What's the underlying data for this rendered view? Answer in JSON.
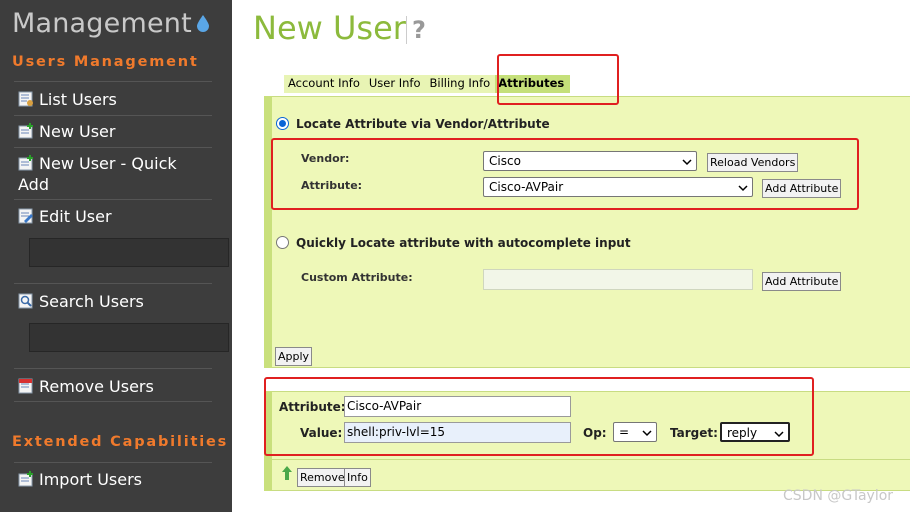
{
  "sidebar": {
    "app_title": "Management",
    "sections": [
      {
        "heading": "Users Management",
        "items": [
          {
            "label": "List Users",
            "icon": "list-users-icon"
          },
          {
            "label": "New User",
            "icon": "new-user-icon"
          },
          {
            "label": "New User - Quick",
            "label_line2": "Add",
            "icon": "new-user-icon"
          },
          {
            "label": "Edit User",
            "icon": "edit-user-icon"
          },
          {
            "label": "Search Users",
            "icon": "search-users-icon"
          },
          {
            "label": "Remove Users",
            "icon": "remove-users-icon"
          }
        ]
      },
      {
        "heading": "Extended Capabilities",
        "items": [
          {
            "label": "Import Users",
            "icon": "import-users-icon"
          }
        ]
      }
    ]
  },
  "page": {
    "title": "New User",
    "help": "?"
  },
  "tabs": [
    {
      "label": "Account Info",
      "active": false
    },
    {
      "label": "User Info",
      "active": false
    },
    {
      "label": "Billing Info",
      "active": false
    },
    {
      "label": "Attributes",
      "active": true
    }
  ],
  "locate": {
    "vendor_option_label": "Locate Attribute via Vendor/Attribute",
    "vendor_label": "Vendor:",
    "vendor_value": "Cisco",
    "reload_vendors": "Reload Vendors",
    "attribute_label": "Attribute:",
    "attribute_value": "Cisco-AVPair",
    "add_attribute": "Add Attribute",
    "quick_option_label": "Quickly Locate attribute with autocomplete input",
    "custom_label": "Custom Attribute:",
    "custom_value": "",
    "add_attribute2": "Add Attribute",
    "apply": "Apply"
  },
  "attribute_row": {
    "attribute_label": "Attribute:",
    "attribute_value": "Cisco-AVPair",
    "value_label": "Value:",
    "value_value": "shell:priv-lvl=15",
    "op_label": "Op:",
    "op_value": "=",
    "target_label": "Target:",
    "target_value": "reply",
    "remove": "Remove",
    "info": "Info"
  },
  "watermark": "CSDN @GTaylor",
  "colors": {
    "sidebar_bg": "#3d3d3d",
    "section_heading": "#f07a2c",
    "title_green": "#8cba3c",
    "panel_bg": "#eef8b8",
    "highlight_red": "#e02020"
  }
}
